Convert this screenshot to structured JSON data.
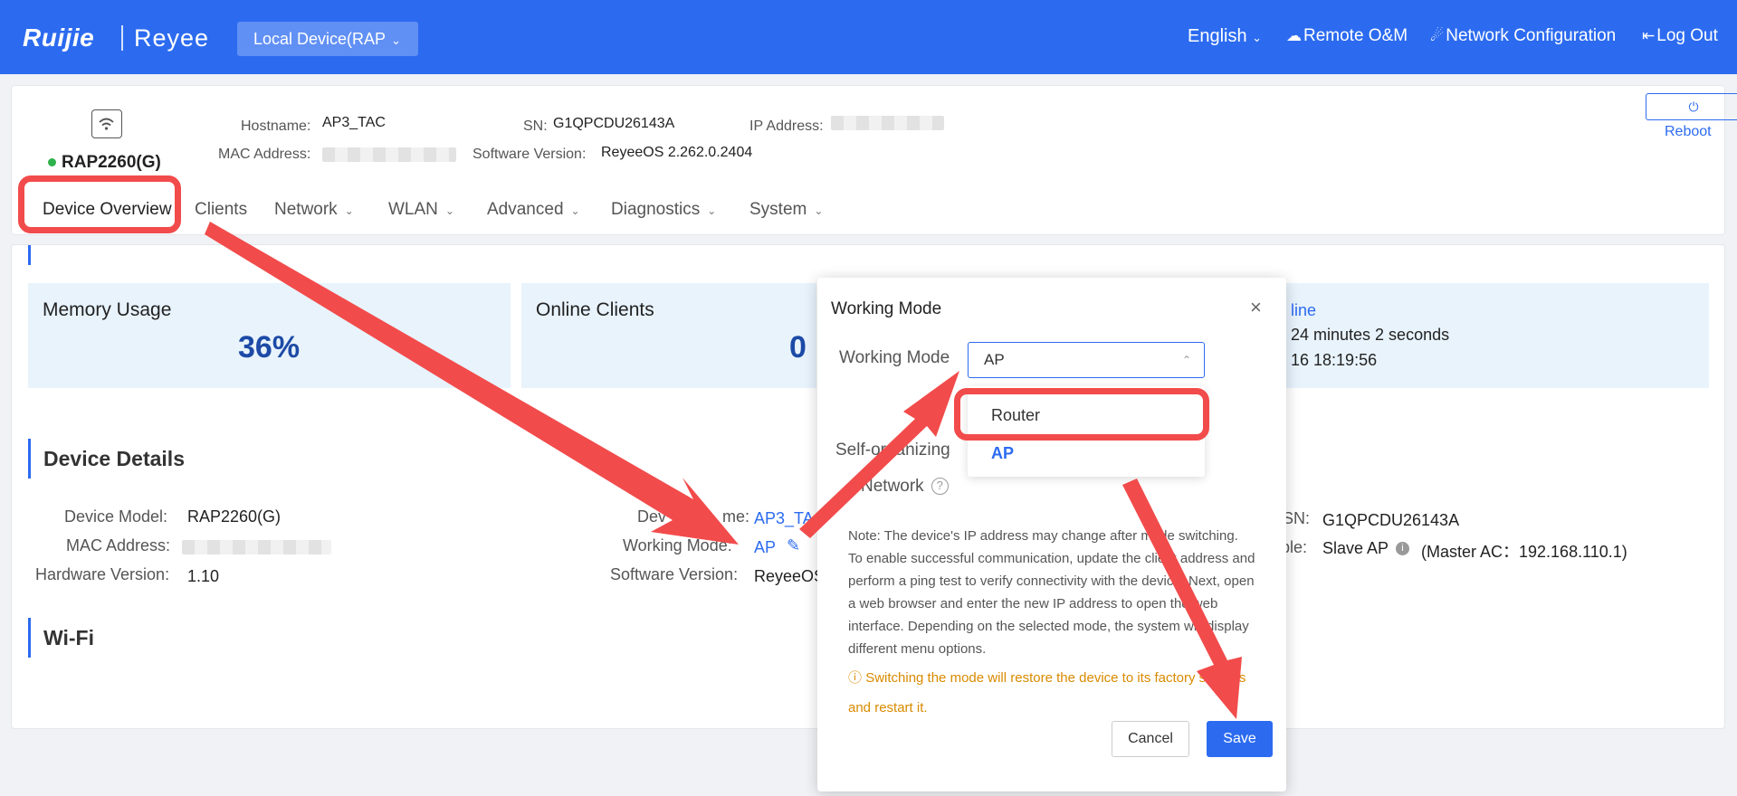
{
  "topbar": {
    "logo_brand": "Ruijie",
    "logo_product": "Reyee",
    "device_select": "Local Device(RAP",
    "language": "English",
    "remote_om": "Remote O&M",
    "network_config": "Network Configuration",
    "logout": "Log Out"
  },
  "header": {
    "model": "RAP2260(G)",
    "hostname_label": "Hostname:",
    "hostname": "AP3_TAC",
    "sn_label": "SN:",
    "sn": "G1QPCDU26143A",
    "ip_label": "IP Address:",
    "mac_label": "MAC Address:",
    "sw_label": "Software Version:",
    "sw": "ReyeeOS 2.262.0.2404",
    "reboot": "Reboot"
  },
  "menu": {
    "items": [
      "Device Overview",
      "Clients",
      "Network",
      "WLAN",
      "Advanced",
      "Diagnostics",
      "System"
    ]
  },
  "stats": {
    "memory_title": "Memory Usage",
    "memory_value": "36%",
    "clients_title": "Online Clients",
    "clients_value": "0",
    "status_partial": "line",
    "uptime_partial": "24 minutes 2 seconds",
    "time_partial": "16 18:19:56"
  },
  "details": {
    "title": "Device Details",
    "model_label": "Device Model:",
    "model": "RAP2260(G)",
    "mac_label": "MAC Address:",
    "hw_label": "Hardware Version:",
    "hw": "1.10",
    "devname_label": "Dev",
    "devname_label2": "me:",
    "devname": "AP3_TA",
    "mode_label": "Working Mode:",
    "mode": "AP",
    "sw_label": "Software Version:",
    "sw_partial": "ReyeeOS",
    "sn_label": "SN:",
    "sn": "G1QPCDU26143A",
    "role_label": "ble:",
    "role": "Slave AP",
    "master": "(Master AC：192.168.110.1)",
    "info_icon": "i"
  },
  "wifi": {
    "title": "Wi-Fi"
  },
  "modal": {
    "title": "Working Mode",
    "close": "×",
    "mode_label": "Working Mode",
    "mode_value": "AP",
    "self_org_1": "Self-organizing",
    "self_org_2": "Network",
    "help": "?",
    "options": [
      "Router",
      "AP"
    ],
    "note": "Note: The device's IP address may change after mode switching. To enable successful communication, update the client address and perform a ping test to verify connectivity with the device. Next, open a web browser and enter the new IP address to open the web interface. Depending on the selected mode, the system will display different menu options.",
    "warning_icon": "ⓘ",
    "warning": "Switching the mode will restore the device to its factory settings and restart it.",
    "cancel": "Cancel",
    "save": "Save"
  },
  "colors": {
    "brand": "#2c6bf0",
    "annotation": "#f24b4b",
    "warning": "#d98a00"
  }
}
